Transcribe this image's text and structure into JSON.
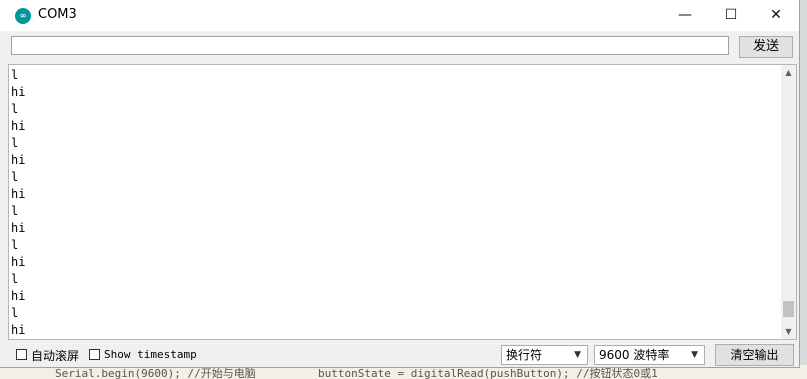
{
  "window": {
    "title": "COM3",
    "controls": {
      "minimize": "—",
      "maximize": "☐",
      "close": "✕"
    }
  },
  "send": {
    "input_value": "",
    "button_label": "发送"
  },
  "output": {
    "lines": [
      "l",
      "hi",
      "l",
      "hi",
      "l",
      "hi",
      "l",
      "hi",
      "l",
      "hi",
      "l",
      "hi",
      "l",
      "hi",
      "l",
      "hi"
    ]
  },
  "footer": {
    "autoscroll_label": "自动滚屏",
    "autoscroll_checked": false,
    "timestamp_label": "Show timestamp",
    "timestamp_checked": false,
    "line_ending": "换行符",
    "baud": "9600 波特率",
    "clear_label": "清空输出"
  },
  "background": {
    "code_left": "Serial.begin(9600);  //开始与电脑",
    "code_right": "buttonState = digitalRead(pushButton);  //按钮状态0或1"
  }
}
